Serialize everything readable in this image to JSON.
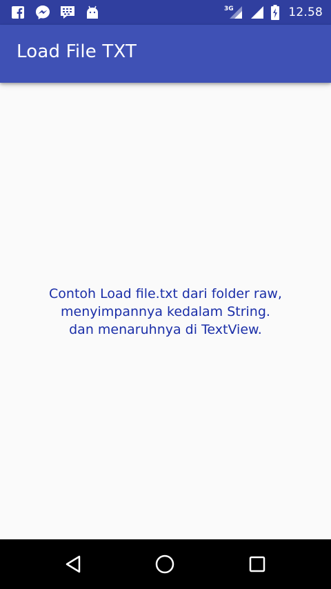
{
  "status_bar": {
    "background_color": "#303f9f",
    "notification_icons": [
      "facebook-icon",
      "messenger-icon",
      "bbm-icon",
      "android-icon"
    ],
    "network_type": "3G",
    "time": "12.58"
  },
  "app_bar": {
    "title": "Load File TXT",
    "background_color": "#3f51b5"
  },
  "content": {
    "lines": [
      "Contoh Load file.txt dari folder raw,",
      "menyimpannya kedalam String.",
      "dan menaruhnya di TextView."
    ],
    "text_color": "#1a2ea8"
  },
  "nav_bar": {
    "buttons": [
      "back-icon",
      "home-icon",
      "recents-icon"
    ]
  }
}
